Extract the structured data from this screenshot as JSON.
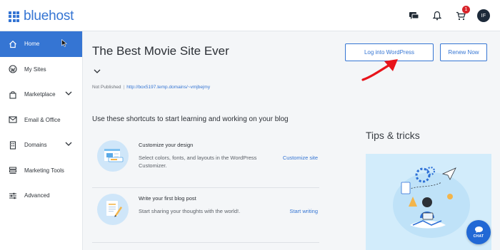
{
  "brand": {
    "name": "bluehost",
    "color": "#3575d3"
  },
  "topbar": {
    "cart_badge": "1",
    "avatar_initials": "IF",
    "icons": [
      "chat-bubble-icon",
      "bell-icon",
      "cart-icon"
    ]
  },
  "sidebar": {
    "items": [
      {
        "label": "Home",
        "icon": "home-icon",
        "active": true
      },
      {
        "label": "My Sites",
        "icon": "wordpress-icon"
      },
      {
        "label": "Marketplace",
        "icon": "shopping-bag-icon",
        "has_chevron": true
      },
      {
        "label": "Email & Office",
        "icon": "envelope-icon"
      },
      {
        "label": "Domains",
        "icon": "building-icon",
        "has_chevron": true
      },
      {
        "label": "Marketing Tools",
        "icon": "stack-icon"
      },
      {
        "label": "Advanced",
        "icon": "sliders-icon"
      }
    ]
  },
  "site": {
    "title": "The Best Movie Site Ever",
    "status": "Not Published",
    "url": "http://box5197.temp.domains/~vmjbejmy"
  },
  "actions": {
    "login_label": "Log into WordPress",
    "renew_label": "Renew Now"
  },
  "shortcuts": {
    "heading": "Use these shortcuts to start learning and working on your blog",
    "cards": [
      {
        "title": "Customize your design",
        "desc": "Select colors, fonts, and layouts in the WordPress Customizer.",
        "link": "Customize site"
      },
      {
        "title": "Write your first blog post",
        "desc": "Start sharing your thoughts with the world!.",
        "link": "Start writing"
      }
    ]
  },
  "tips": {
    "heading": "Tips & tricks"
  },
  "chat": {
    "label": "CHAT"
  }
}
